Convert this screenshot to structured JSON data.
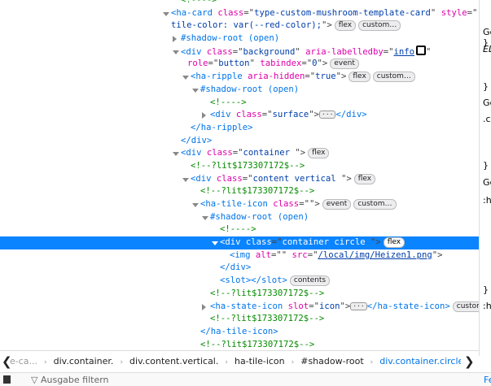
{
  "tree": [
    {
      "level": 1,
      "tokens": [
        [
          "cm",
          "<!---->"
        ]
      ]
    },
    {
      "level": 0,
      "twisty": "open",
      "tokens": [
        [
          "tag",
          "<ha-card "
        ],
        [
          "attr",
          "class"
        ],
        [
          "pun",
          "=\""
        ],
        [
          "val",
          "type-custom-mushroom-template-card"
        ],
        [
          "pun",
          "\" "
        ],
        [
          "attr",
          "style"
        ],
        [
          "pun",
          "=\""
        ],
        [
          "val",
          "--"
        ]
      ]
    },
    {
      "level": 0,
      "tokens": [
        [
          "val",
          "tile-color: var(--red-color);"
        ],
        [
          "pun",
          "\">"
        ],
        [
          "badge",
          "flex"
        ],
        [
          "badge",
          "custom…"
        ]
      ]
    },
    {
      "level": 1,
      "twisty": "closed",
      "tokens": [
        [
          "tag",
          "#shadow-root (open)"
        ]
      ]
    },
    {
      "level": 1,
      "twisty": "open",
      "tokens": [
        [
          "tag",
          "<div "
        ],
        [
          "attr",
          "class"
        ],
        [
          "pun",
          "=\""
        ],
        [
          "val",
          "background"
        ],
        [
          "pun",
          "\" "
        ],
        [
          "attr",
          "aria-labelledby"
        ],
        [
          "pun",
          "=\""
        ],
        [
          "link",
          "info"
        ],
        [
          "cross",
          ""
        ],
        [
          "pun",
          "\""
        ]
      ]
    },
    {
      "level": 1,
      "indent": 1,
      "tokens": [
        [
          "attr",
          "role"
        ],
        [
          "pun",
          "=\""
        ],
        [
          "val",
          "button"
        ],
        [
          "pun",
          "\" "
        ],
        [
          "attr",
          "tabindex"
        ],
        [
          "pun",
          "=\""
        ],
        [
          "val",
          "0"
        ],
        [
          "pun",
          "\">"
        ],
        [
          "badge",
          "event"
        ]
      ]
    },
    {
      "level": 2,
      "twisty": "open",
      "tokens": [
        [
          "tag",
          "<ha-ripple "
        ],
        [
          "attr",
          "aria-hidden"
        ],
        [
          "pun",
          "=\""
        ],
        [
          "val",
          "true"
        ],
        [
          "pun",
          "\">"
        ],
        [
          "badge",
          "flex"
        ],
        [
          "badge",
          "custom…"
        ]
      ]
    },
    {
      "level": 3,
      "twisty": "open",
      "tokens": [
        [
          "tag",
          "#shadow-root (open)"
        ]
      ]
    },
    {
      "level": 4,
      "tokens": [
        [
          "cm",
          "<!---->"
        ]
      ]
    },
    {
      "level": 4,
      "twisty": "closed",
      "tokens": [
        [
          "tag",
          "<div "
        ],
        [
          "attr",
          "class"
        ],
        [
          "pun",
          "=\""
        ],
        [
          "val",
          "surface"
        ],
        [
          "pun",
          "\">"
        ],
        [
          "ell",
          "···"
        ],
        [
          "tag",
          "</div>"
        ]
      ]
    },
    {
      "level": 2,
      "tokens": [
        [
          "tag",
          "</ha-ripple>"
        ]
      ]
    },
    {
      "level": 1,
      "tokens": [
        [
          "tag",
          "</div>"
        ]
      ]
    },
    {
      "level": 1,
      "twisty": "open",
      "tokens": [
        [
          "tag",
          "<div "
        ],
        [
          "attr",
          "class"
        ],
        [
          "pun",
          "=\""
        ],
        [
          "val",
          "container "
        ],
        [
          "pun",
          "\">"
        ],
        [
          "badge",
          "flex"
        ]
      ]
    },
    {
      "level": 2,
      "tokens": [
        [
          "cm",
          "<!--?lit$173307172$-->"
        ]
      ]
    },
    {
      "level": 2,
      "twisty": "open",
      "tokens": [
        [
          "tag",
          "<div "
        ],
        [
          "attr",
          "class"
        ],
        [
          "pun",
          "=\""
        ],
        [
          "val",
          "content vertical "
        ],
        [
          "pun",
          "\">"
        ],
        [
          "badge",
          "flex"
        ]
      ]
    },
    {
      "level": 3,
      "tokens": [
        [
          "cm",
          "<!--?lit$173307172$-->"
        ]
      ]
    },
    {
      "level": 3,
      "twisty": "open",
      "tokens": [
        [
          "tag",
          "<ha-tile-icon "
        ],
        [
          "attr",
          "class"
        ],
        [
          "pun",
          "=\"\">"
        ],
        [
          "badge",
          "event"
        ],
        [
          "badge",
          "custom…"
        ]
      ]
    },
    {
      "level": 4,
      "twisty": "open",
      "tokens": [
        [
          "tag",
          "#shadow-root (open)"
        ]
      ]
    },
    {
      "level": 5,
      "tokens": [
        [
          "cm",
          "<!---->"
        ]
      ]
    },
    {
      "level": 5,
      "twisty": "open",
      "selected": true,
      "tokens": [
        [
          "tag",
          "<div "
        ],
        [
          "attr",
          "class"
        ],
        [
          "pun",
          "=\""
        ],
        [
          "val",
          "container circle "
        ],
        [
          "pun",
          "\">"
        ],
        [
          "badge",
          "flex"
        ]
      ]
    },
    {
      "level": 6,
      "tokens": [
        [
          "tag",
          "<img "
        ],
        [
          "attr",
          "alt"
        ],
        [
          "pun",
          "=\"\" "
        ],
        [
          "attr",
          "src"
        ],
        [
          "pun",
          "=\""
        ],
        [
          "link",
          "/local/img/Heizen1.png"
        ],
        [
          "pun",
          "\">"
        ]
      ]
    },
    {
      "level": 5,
      "tokens": [
        [
          "tag",
          "</div>"
        ]
      ]
    },
    {
      "level": 5,
      "tokens": [
        [
          "tag",
          "<slot></slot>"
        ],
        [
          "badge",
          "contents"
        ]
      ]
    },
    {
      "level": 4,
      "tokens": [
        [
          "cm",
          "<!--?lit$173307172$-->"
        ]
      ]
    },
    {
      "level": 4,
      "twisty": "closed",
      "tokens": [
        [
          "tag",
          "<ha-state-icon "
        ],
        [
          "attr",
          "slot"
        ],
        [
          "pun",
          "=\""
        ],
        [
          "val",
          "icon"
        ],
        [
          "pun",
          "\">"
        ],
        [
          "ell",
          "···"
        ],
        [
          "tag",
          "</ha-state-icon>"
        ],
        [
          "badge",
          "custom…"
        ]
      ]
    },
    {
      "level": 4,
      "tokens": [
        [
          "cm",
          "<!--?lit$173307172$-->"
        ]
      ]
    },
    {
      "level": 3,
      "tokens": [
        [
          "tag",
          "</ha-tile-icon>"
        ]
      ]
    },
    {
      "level": 3,
      "tokens": [
        [
          "cm",
          "<!--?lit$173307172$-->"
        ]
      ]
    }
  ],
  "side": {
    "lines": [
      "}",
      "Ge",
      "EL",
      "}",
      "Ge",
      ".c",
      "}",
      "Ge",
      ":h",
      "}",
      ":h"
    ]
  },
  "breadcrumbs": {
    "items": [
      "e-ca...",
      "div.container.",
      "div.content.vertical.",
      "ha-tile-icon",
      "#shadow-root",
      "div.container.circle.",
      "img"
    ],
    "current_index": 5
  },
  "console": {
    "filter_placeholder": "Ausgabe filtern",
    "right_label": "Fe"
  }
}
